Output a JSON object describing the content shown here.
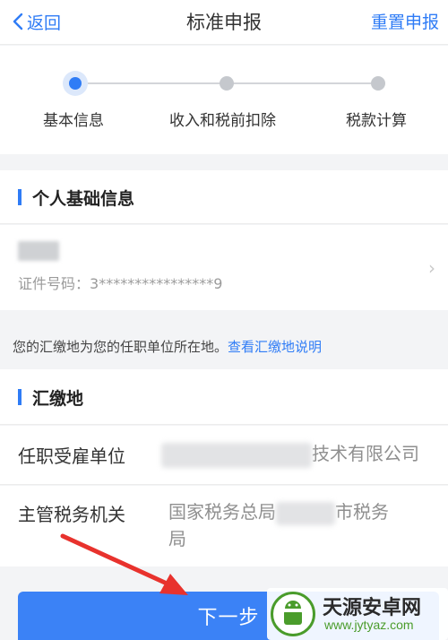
{
  "nav": {
    "back_label": "返回",
    "title": "标准申报",
    "reset_label": "重置申报"
  },
  "steps": [
    {
      "label": "基本信息",
      "active": true
    },
    {
      "label": "收入和税前扣除",
      "active": false
    },
    {
      "label": "税款计算",
      "active": false
    }
  ],
  "personal": {
    "section_title": "个人基础信息",
    "id_label": "证件号码：",
    "id_value": "3****************9"
  },
  "notice": {
    "text": "您的汇缴地为您的任职单位所在地。",
    "link": "查看汇缴地说明"
  },
  "remit": {
    "section_title": "汇缴地",
    "employer_label": "任职受雇单位",
    "employer_value": "技术有限公司",
    "tax_office_label": "主管税务机关",
    "tax_office_value_prefix": "国家税务总局",
    "tax_office_value_suffix": "市税务",
    "tax_office_value_line2": "局"
  },
  "footer": {
    "next_label": "下一步"
  },
  "watermark": {
    "brand": "天源安卓网",
    "url": "www.jytyaz.com"
  },
  "colors": {
    "accent": "#2f7cf6",
    "button": "#3b82f6",
    "annotation_arrow": "#e8322d",
    "watermark_green": "#4a9c2b"
  }
}
